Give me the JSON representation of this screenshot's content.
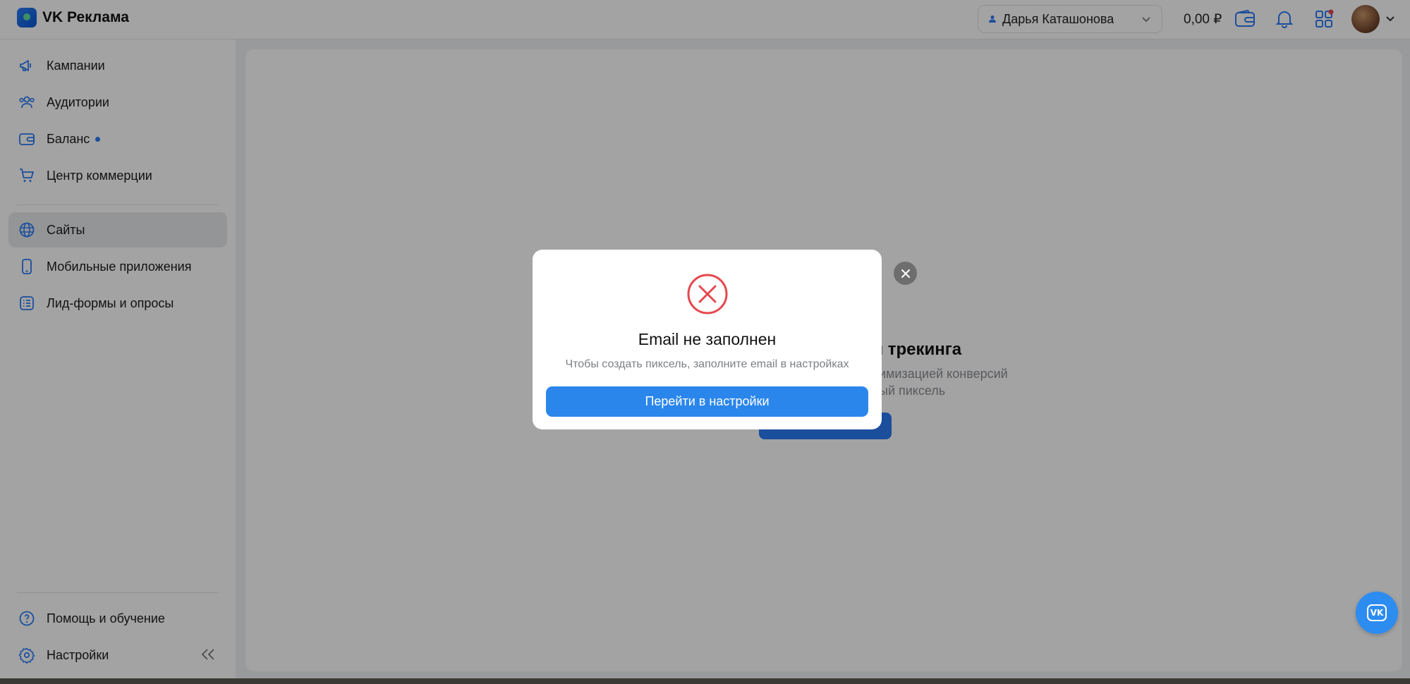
{
  "header": {
    "logo_text": "VK Реклама",
    "account_name": "Дарья Каташонова",
    "balance": "0,00 ₽",
    "icons": [
      "wallet-icon",
      "bell-icon",
      "apps-icon",
      "avatar"
    ]
  },
  "sidebar": {
    "items": [
      {
        "label": "Кампании",
        "icon": "megaphone-icon"
      },
      {
        "label": "Аудитории",
        "icon": "users-icon"
      },
      {
        "label": "Баланс",
        "icon": "wallet-icon"
      },
      {
        "label": "Центр коммерции",
        "icon": "cart-icon"
      },
      {
        "label": "Сайты",
        "icon": "globe-icon"
      },
      {
        "label": "Мобильные приложения",
        "icon": "phone-icon"
      },
      {
        "label": "Лид-формы и опросы",
        "icon": "list-icon"
      }
    ],
    "footer": [
      {
        "label": "Помощь и обучение",
        "icon": "help-icon"
      },
      {
        "label": "Настройки",
        "icon": "gear-icon"
      }
    ]
  },
  "background": {
    "title_fragment": "ей трекинга",
    "desc_line1": "имизацией конверсий",
    "desc_line2": "ый пиксель"
  },
  "modal": {
    "title": "Email не заполнен",
    "text": "Чтобы создать пиксель, заполните email в настройках",
    "button": "Перейти в настройки"
  },
  "colors": {
    "accent": "#2b86ec",
    "error": "#e5484d"
  }
}
